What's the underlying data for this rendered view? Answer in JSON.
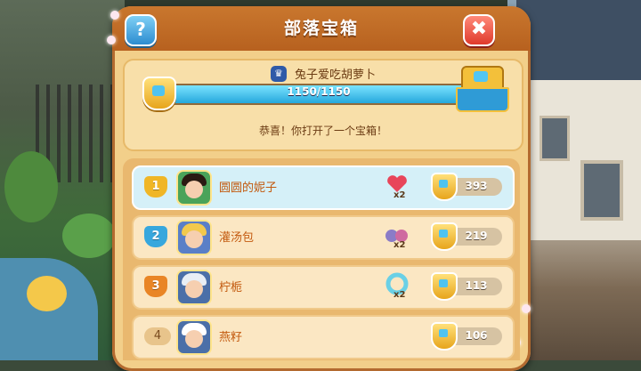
{
  "header": {
    "title": "部落宝箱",
    "help_label": "?",
    "close_label": "✖"
  },
  "tribe": {
    "name": "兔子爱吃胡萝卜",
    "icon": "crown-shield-icon",
    "progress_text": "1150/1150",
    "progress_fraction": 1.0,
    "message": "恭喜！你打开了一个宝箱！"
  },
  "ranking": [
    {
      "rank": "1",
      "name": "圆圆的妮子",
      "item_icon": "heart-gift-icon",
      "item_count": "x2",
      "score": "393",
      "highlight": true,
      "badge_color": "#f0b626",
      "hair": "#2a1a12",
      "bg": "#4aa35a"
    },
    {
      "rank": "2",
      "name": "灌汤包",
      "item_icon": "potion-bottles-icon",
      "item_count": "x2",
      "score": "219",
      "highlight": false,
      "badge_color": "#37a7dd",
      "hair": "#f2c94c",
      "bg": "#5a7fc7"
    },
    {
      "rank": "3",
      "name": "柠栀",
      "item_icon": "color-wheel-icon",
      "item_count": "x2",
      "score": "113",
      "highlight": false,
      "badge_color": "#e98525",
      "hair": "#e8eef5",
      "bg": "#4b6fa8"
    },
    {
      "rank": "4",
      "name": "燕籽",
      "item_icon": "",
      "item_count": "",
      "score": "106",
      "highlight": false,
      "badge_color": "",
      "hair": "#ffffff",
      "bg": "#4b6fa8"
    }
  ]
}
